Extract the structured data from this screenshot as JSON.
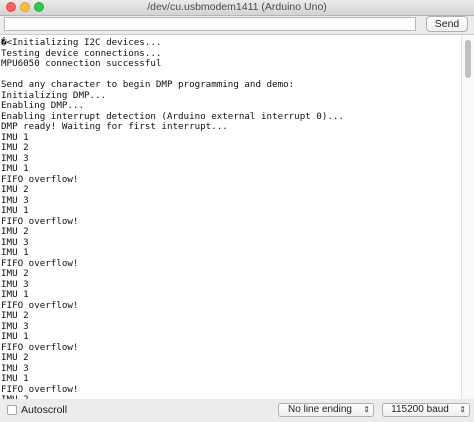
{
  "window": {
    "title": "/dev/cu.usbmodem1411 (Arduino Uno)"
  },
  "toolbar": {
    "input_value": "",
    "send_label": "Send"
  },
  "output": {
    "lines": [
      "�<Initializing I2C devices...",
      "Testing device connections...",
      "MPU6050 connection successful",
      "",
      "Send any character to begin DMP programming and demo:",
      "Initializing DMP...",
      "Enabling DMP...",
      "Enabling interrupt detection (Arduino external interrupt 0)...",
      "DMP ready! Waiting for first interrupt...",
      "IMU 1",
      "IMU 2",
      "IMU 3",
      "IMU 1",
      "FIFO overflow!",
      "IMU 2",
      "IMU 3",
      "IMU 1",
      "FIFO overflow!",
      "IMU 2",
      "IMU 3",
      "IMU 1",
      "FIFO overflow!",
      "IMU 2",
      "IMU 3",
      "IMU 1",
      "FIFO overflow!",
      "IMU 2",
      "IMU 3",
      "IMU 1",
      "FIFO overflow!",
      "IMU 2",
      "IMU 3",
      "IMU 1",
      "FIFO overflow!",
      "IMU 2"
    ]
  },
  "status": {
    "autoscroll_label": "Autoscroll",
    "autoscroll_checked": false,
    "line_ending": "No line ending",
    "baud": "115200 baud"
  }
}
